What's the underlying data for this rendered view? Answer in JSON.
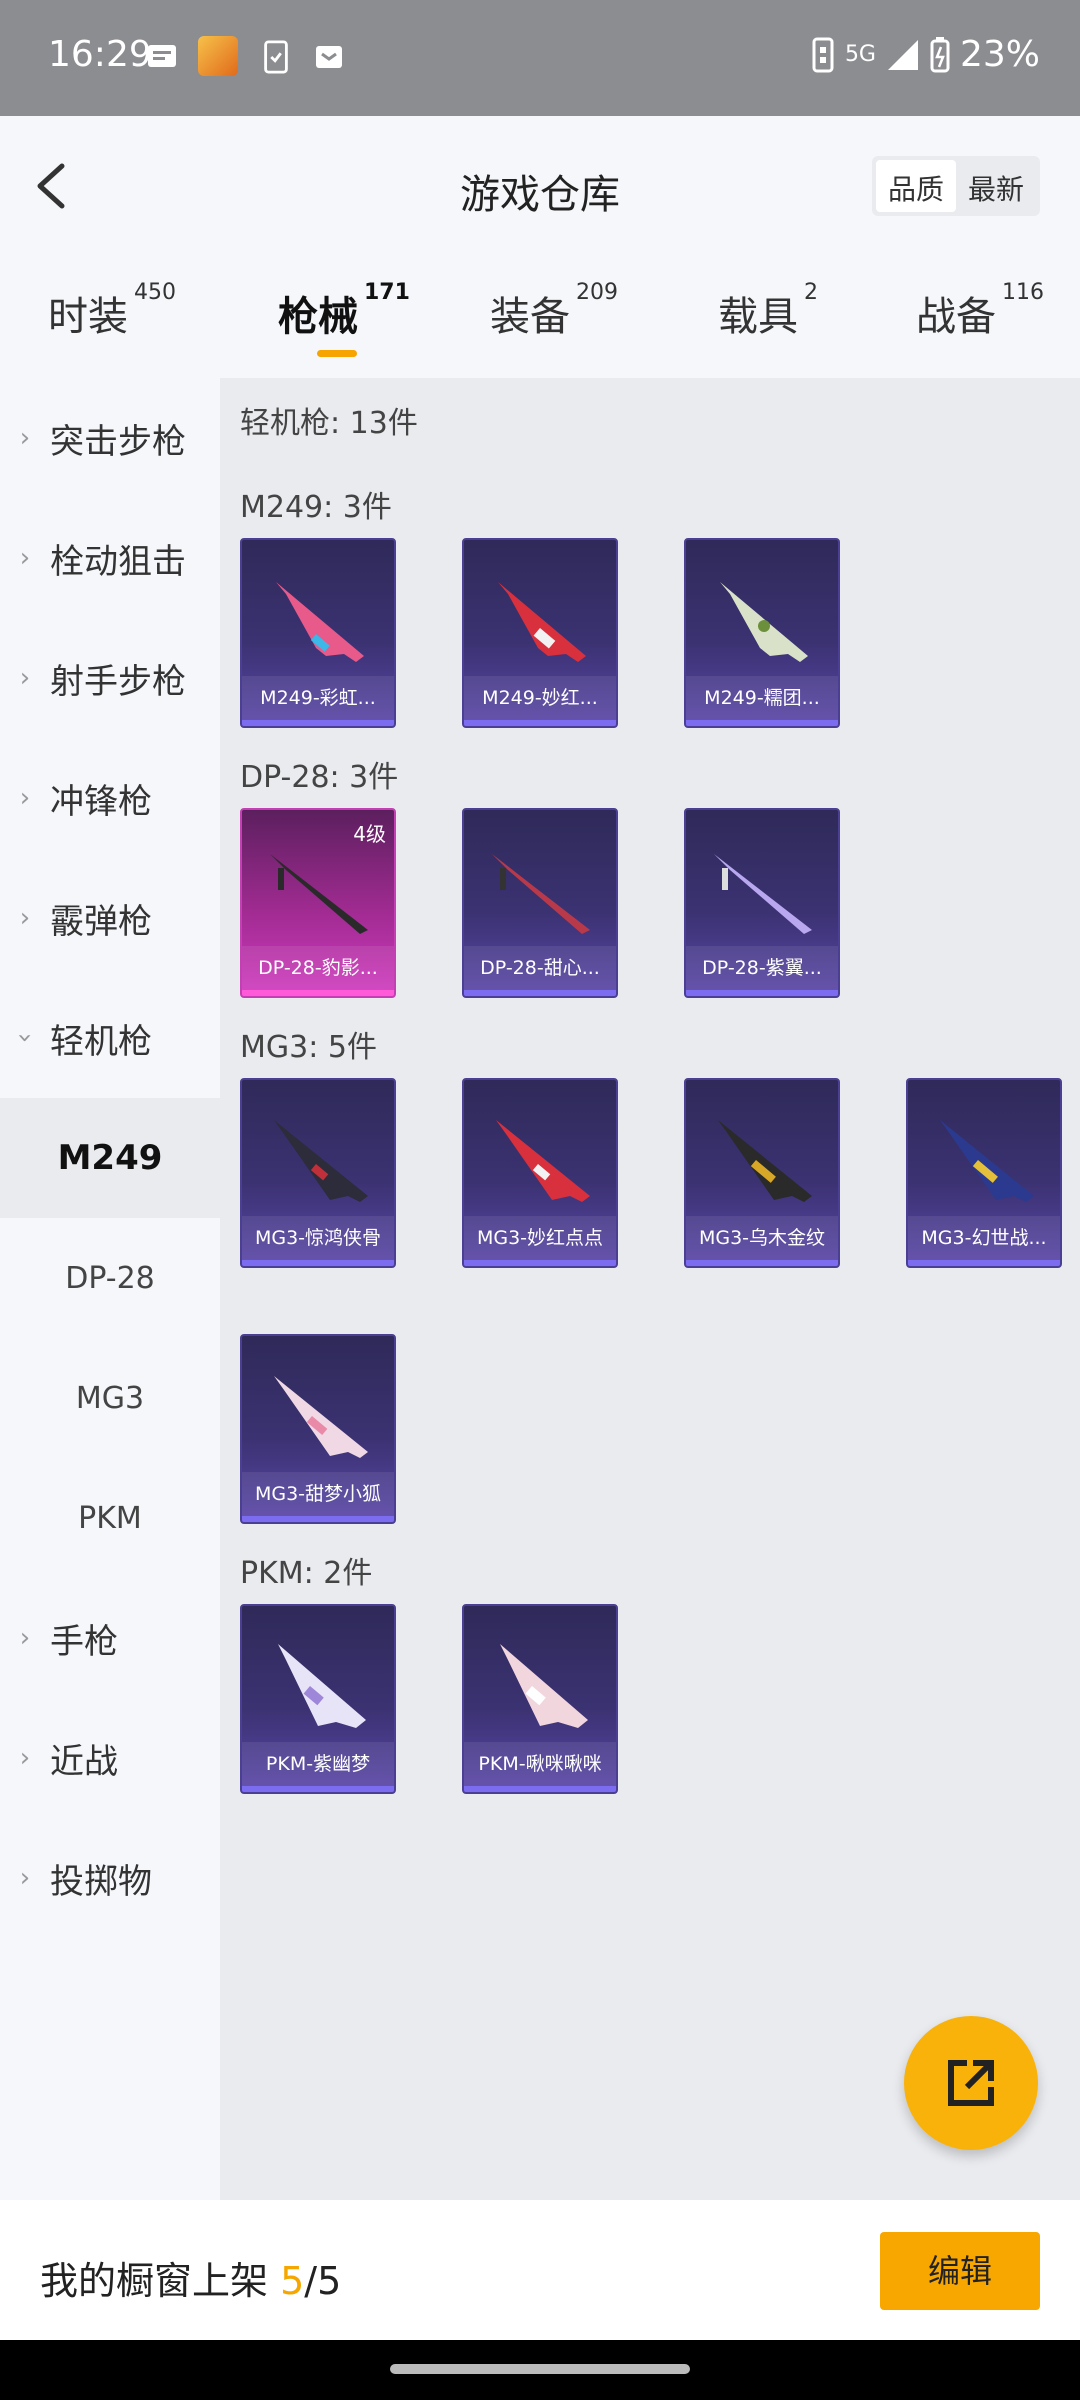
{
  "status_bar": {
    "time": "16:29",
    "network": "5G",
    "battery": "23%"
  },
  "header": {
    "title": "游戏仓库",
    "sort_options": [
      "品质",
      "最新"
    ],
    "sort_active": "品质"
  },
  "tabs": [
    {
      "label": "时装",
      "count": "450"
    },
    {
      "label": "枪械",
      "count": "171"
    },
    {
      "label": "装备",
      "count": "209"
    },
    {
      "label": "载具",
      "count": "2"
    },
    {
      "label": "战备",
      "count": "116"
    }
  ],
  "sidebar": {
    "categories": [
      "突击步枪",
      "栓动狙击",
      "射手步枪",
      "冲锋枪",
      "霰弹枪",
      "轻机枪",
      "手枪",
      "近战",
      "投掷物"
    ],
    "expanded": "轻机枪",
    "subitems": [
      "M249",
      "DP-28",
      "MG3",
      "PKM"
    ],
    "active_sub": "M249"
  },
  "content": {
    "summary": "轻机枪: 13件",
    "groups": [
      {
        "title": "M249: 3件",
        "items": [
          "M249-彩虹...",
          "M249-妙红...",
          "M249-糯团..."
        ]
      },
      {
        "title": "DP-28: 3件",
        "items": [
          "DP-28-豹影...",
          "DP-28-甜心...",
          "DP-28-紫翼..."
        ]
      },
      {
        "title": "MG3: 5件",
        "items": [
          "MG3-惊鸿侠骨",
          "MG3-妙红点点",
          "MG3-乌木金纹",
          "MG3-幻世战...",
          "MG3-甜梦小狐"
        ]
      },
      {
        "title": "PKM: 2件",
        "items": [
          "PKM-紫幽梦",
          "PKM-啾咪啾咪"
        ]
      }
    ],
    "special_level": "4级"
  },
  "bottom": {
    "prefix": "我的橱窗上架 ",
    "current": "5",
    "total": "/5",
    "edit_label": "编辑"
  },
  "colors": {
    "accent": "#f7a700",
    "card_purple": "#3b3272",
    "card_pink": "#a12b92"
  }
}
